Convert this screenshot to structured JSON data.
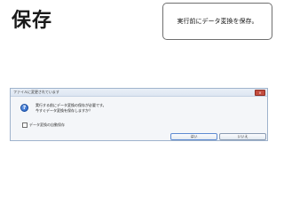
{
  "slide": {
    "title": "保存",
    "callout": "実行前にデータ変換を保存。"
  },
  "dialog": {
    "title": "ファイルに変更されています",
    "close_label": "×",
    "icon": "question-icon",
    "icon_glyph": "?",
    "message_line1": "実行する前にデータ変換の保存が必要です。",
    "message_line2": "今すぐデータ変換を保存しますか？",
    "checkbox_label": "データ変換の自動保存",
    "checkbox_checked": false,
    "yes_label": "はい",
    "no_label": "いいえ"
  }
}
